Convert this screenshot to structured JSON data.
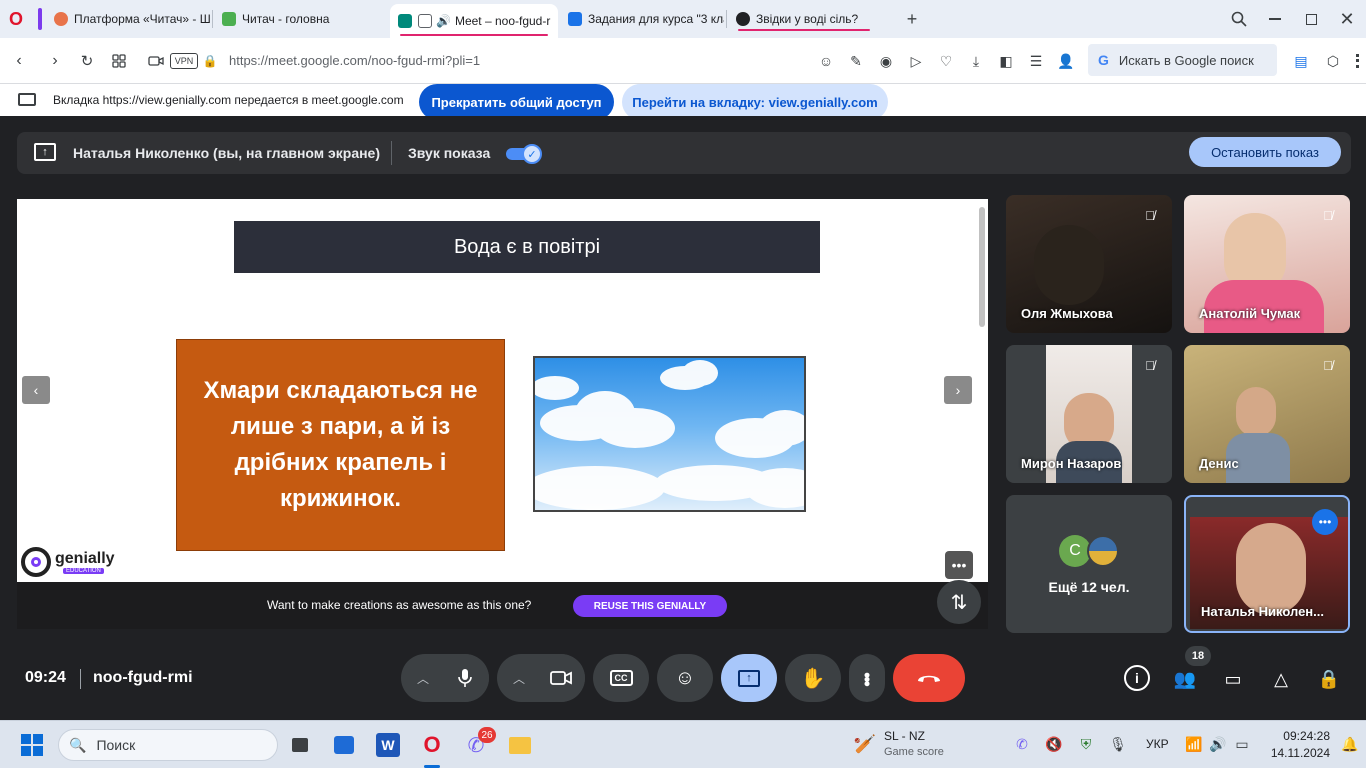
{
  "browser": {
    "tabs": [
      {
        "title": "Платформа «Читач» - Ш",
        "color": "#e8734a"
      },
      {
        "title": "Читач - головна",
        "color": "#4caf50"
      },
      {
        "title": "Meet – noo-fgud-r",
        "color": "#00897b"
      },
      {
        "title": "Задания для курса \"3 кла",
        "color": "#1a73e8"
      },
      {
        "title": "Звідки у воді сіль?",
        "color": "#202124"
      }
    ],
    "vpn_label": "VPN",
    "url": "https://meet.google.com/noo-fgud-rmi?pli=1",
    "search_box": "Искать в Google поиск"
  },
  "infobar": {
    "message": "Вкладка https://view.genially.com передается в meet.google.com",
    "stop_sharing": "Прекратить общий доступ",
    "goto_tab": "Перейти на вкладку: view.genially.com"
  },
  "share_bar": {
    "presenter": "Наталья Николенко (вы, на главном экране)",
    "sound_label": "Звук показа",
    "sound_on": true,
    "stop_button": "Остановить показ"
  },
  "slide": {
    "title": "Вода є в повітрі",
    "text": "Хмари складаються не лише з пари, а й із дрібних крапель і крижинок.",
    "brand": "genially",
    "brand_sub": "EDUCATION",
    "promo_text": "Want to make creations as awesome as this one?",
    "promo_button": "REUSE THIS GENIALLY"
  },
  "participants": [
    {
      "name": "Оля Жмыхова",
      "muted": true
    },
    {
      "name": "Анатолій Чумак",
      "muted": true
    },
    {
      "name": "Мирон Назаров",
      "muted": true
    },
    {
      "name": "Денис",
      "muted": true
    },
    {
      "name": "Ещё 12 чел.",
      "avatar_letter": "С"
    },
    {
      "name": "Наталья Николен..."
    }
  ],
  "meeting": {
    "time": "09:24",
    "code": "noo-fgud-rmi",
    "participants_count": "18"
  },
  "taskbar": {
    "search_placeholder": "Поиск",
    "viber_badge": "26",
    "weather_title": "SL - NZ",
    "weather_sub": "Game score",
    "language": "УКР",
    "clock_time": "09:24:28",
    "clock_date": "14.11.2024"
  },
  "colors": {
    "meet_bg": "#202124",
    "accent_blue": "#a8c7fa",
    "end_call_red": "#ea4335",
    "slide_orange": "#c55a11",
    "promo_purple": "#7a3cf5"
  }
}
